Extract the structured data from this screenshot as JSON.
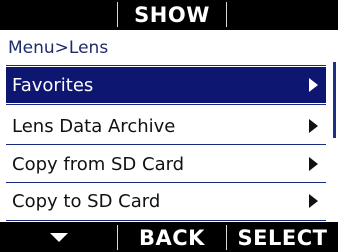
{
  "top_bar": {
    "left_label": "",
    "center_label": "SHOW",
    "right_label": ""
  },
  "breadcrumb": "Menu>Lens",
  "menu": {
    "items": [
      {
        "label": "Favorites",
        "selected": true
      },
      {
        "label": "Lens Data Archive",
        "selected": false
      },
      {
        "label": "Copy from SD Card",
        "selected": false
      },
      {
        "label": "Copy to SD Card",
        "selected": false
      }
    ]
  },
  "bottom_bar": {
    "left_icon": "arrow-down-icon",
    "center_label": "BACK",
    "right_label": "SELECT"
  },
  "colors": {
    "selection": "#0d1670",
    "accent": "#1f2a6b",
    "bar_background": "#000000"
  }
}
